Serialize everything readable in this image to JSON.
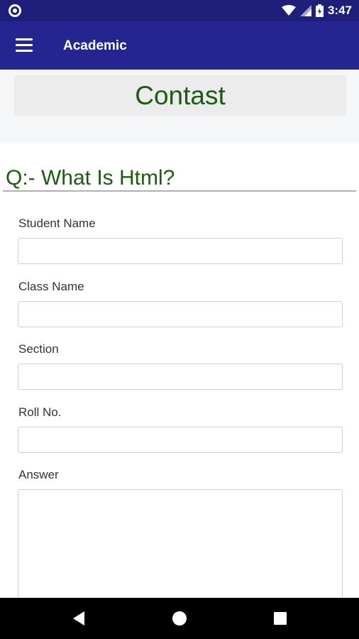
{
  "status_bar": {
    "time": "3:47"
  },
  "app_bar": {
    "title": "Academic"
  },
  "header": {
    "title": "Contast"
  },
  "question": {
    "text": "Q:- What Is Html?"
  },
  "form": {
    "fields": [
      {
        "label": "Student Name",
        "value": ""
      },
      {
        "label": "Class Name",
        "value": ""
      },
      {
        "label": "Section",
        "value": ""
      },
      {
        "label": "Roll No.",
        "value": ""
      },
      {
        "label": "Answer",
        "value": ""
      }
    ]
  },
  "colors": {
    "app_bar": "#252591",
    "status_bar": "#1f1f7a",
    "accent_green": "#1e5a14"
  },
  "icons": [
    "menu-icon",
    "wifi-icon",
    "signal-icon",
    "battery-icon",
    "back-icon",
    "home-icon",
    "recents-icon"
  ]
}
